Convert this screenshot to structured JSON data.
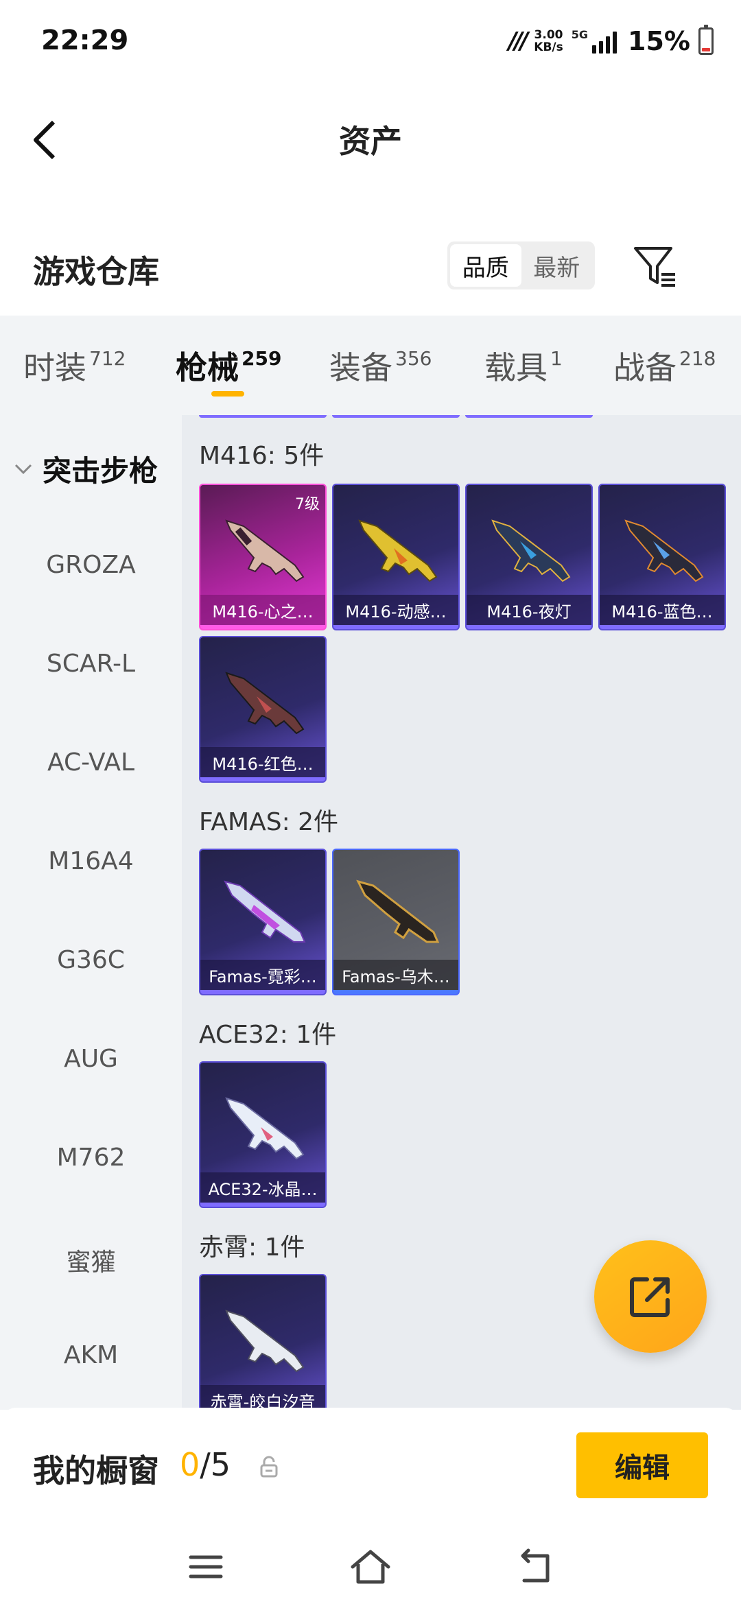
{
  "status_bar": {
    "time": "22:29",
    "net_speed_value": "3.00",
    "net_speed_unit": "KB/s",
    "network_type": "5G",
    "battery": "15%",
    "battery_level": 0.15
  },
  "header": {
    "title": "资产"
  },
  "warehouse": {
    "title": "游戏仓库",
    "sort_options": [
      "品质",
      "最新"
    ],
    "sort_selected": "品质"
  },
  "tabs": [
    {
      "label": "时装",
      "count": "712"
    },
    {
      "label": "枪械",
      "count": "259",
      "active": true
    },
    {
      "label": "装备",
      "count": "356"
    },
    {
      "label": "载具",
      "count": "1"
    },
    {
      "label": "战备",
      "count": "218"
    }
  ],
  "sidebar": {
    "section": "突击步枪",
    "items": [
      "GROZA",
      "SCAR-L",
      "AC-VAL",
      "M16A4",
      "G36C",
      "AUG",
      "M762",
      "蜜獾",
      "AKM"
    ]
  },
  "groups": [
    {
      "title": "M416: 5件",
      "items": [
        {
          "label": "M416-心之…",
          "level": "7级",
          "rarity": "pink"
        },
        {
          "label": "M416-动感…",
          "rarity": "purple"
        },
        {
          "label": "M416-夜灯",
          "rarity": "purple"
        },
        {
          "label": "M416-蓝色…",
          "rarity": "purple"
        },
        {
          "label": "M416-红色…",
          "rarity": "purple"
        }
      ]
    },
    {
      "title": "FAMAS: 2件",
      "items": [
        {
          "label": "Famas-霓彩…",
          "rarity": "purple"
        },
        {
          "label": "Famas-乌木…",
          "rarity": "grey"
        }
      ]
    },
    {
      "title": "ACE32: 1件",
      "items": [
        {
          "label": "ACE32-冰晶…",
          "rarity": "purple"
        }
      ]
    },
    {
      "title": "赤霄: 1件",
      "items": [
        {
          "label": "赤霄-皎白汐音",
          "rarity": "purple"
        }
      ]
    }
  ],
  "showcase": {
    "title": "我的橱窗",
    "current": "0",
    "total": "/5",
    "edit_label": "编辑"
  },
  "colors": {
    "accent": "#ffb300",
    "rarity_purple": "#5b4fd8",
    "rarity_pink": "#e73ad8"
  }
}
